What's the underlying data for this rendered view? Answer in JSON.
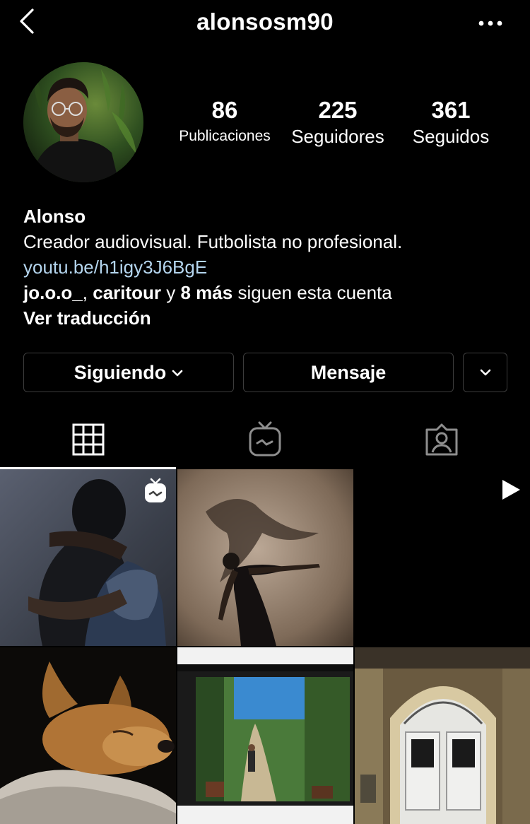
{
  "header": {
    "username": "alonsosm90",
    "back_icon": "chevron-left-icon",
    "more_icon": "more-horizontal-icon"
  },
  "profile": {
    "avatar_icon": "profile-photo",
    "stats": [
      {
        "value": "86",
        "label": "Publicaciones"
      },
      {
        "value": "225",
        "label": "Seguidores"
      },
      {
        "value": "361",
        "label": "Seguidos"
      }
    ],
    "name": "Alonso",
    "bio": "Creador audiovisual. Futbolista no profesional.",
    "link": "youtu.be/h1igy3J6BgE",
    "followed_by": {
      "user1": "jo.o.o_",
      "sep": ", ",
      "user2": "caritour",
      "connector": " y ",
      "more": "8 más",
      "suffix": " siguen esta cuenta"
    },
    "see_translation": "Ver traducción"
  },
  "actions": {
    "following_label": "Siguiendo",
    "message_label": "Mensaje"
  },
  "tabs": [
    {
      "icon": "grid-icon",
      "active": true
    },
    {
      "icon": "igtv-icon",
      "active": false
    },
    {
      "icon": "tagged-icon",
      "active": false
    }
  ],
  "posts": [
    {
      "icon": "photo-hug",
      "badge": "igtv-icon"
    },
    {
      "icon": "photo-dancer-shadow",
      "badge": null
    },
    {
      "icon": "photo-black",
      "badge": "play-icon"
    },
    {
      "icon": "photo-dog",
      "badge": null
    },
    {
      "icon": "photo-garden-path",
      "badge": null
    },
    {
      "icon": "photo-arched-door",
      "badge": null
    }
  ],
  "colors": {
    "background": "#000000",
    "text": "#ffffff",
    "link": "#b4d5ee",
    "button_border": "#3c3c3c"
  }
}
